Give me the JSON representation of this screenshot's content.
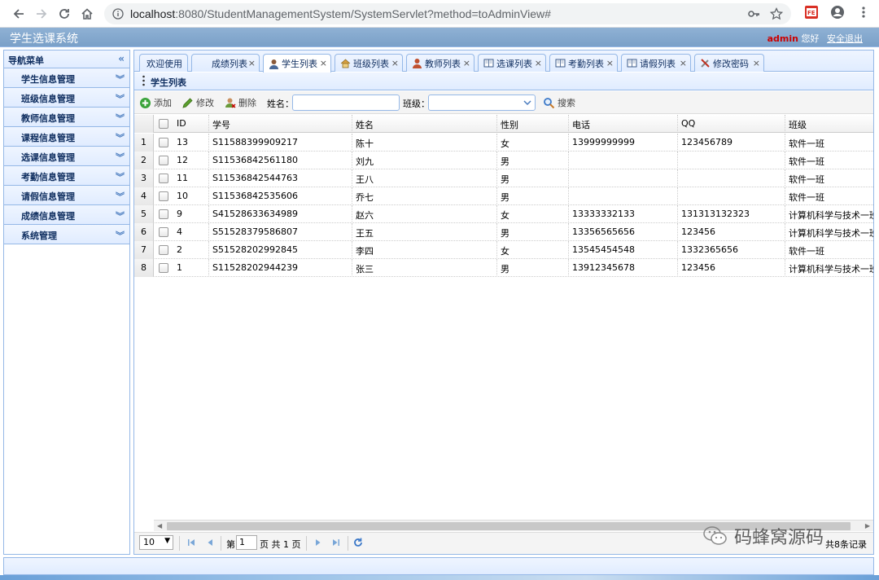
{
  "browser": {
    "url_host": "localhost",
    "url_path": ":8080/StudentManagementSystem/SystemServlet?method=toAdminView#"
  },
  "app": {
    "title": "学生选课系统",
    "user": "admin",
    "greeting": "您好",
    "logout": "安全退出"
  },
  "sidebar": {
    "title": "导航菜单",
    "items": [
      {
        "label": "学生信息管理"
      },
      {
        "label": "班级信息管理"
      },
      {
        "label": "教师信息管理"
      },
      {
        "label": "课程信息管理"
      },
      {
        "label": "选课信息管理"
      },
      {
        "label": "考勤信息管理"
      },
      {
        "label": "请假信息管理"
      },
      {
        "label": "成绩信息管理"
      },
      {
        "label": "系统管理"
      }
    ]
  },
  "tabs": [
    {
      "label": "欢迎使用",
      "icon": "none"
    },
    {
      "label": "成绩列表",
      "icon": "none"
    },
    {
      "label": "学生列表",
      "icon": "user-icon"
    },
    {
      "label": "班级列表",
      "icon": "house-icon"
    },
    {
      "label": "教师列表",
      "icon": "teacher-icon"
    },
    {
      "label": "选课列表",
      "icon": "book-icon"
    },
    {
      "label": "考勤列表",
      "icon": "book-icon"
    },
    {
      "label": "请假列表",
      "icon": "book-icon"
    },
    {
      "label": "修改密码",
      "icon": "tools-icon"
    }
  ],
  "panel": {
    "title": "学生列表"
  },
  "toolbar": {
    "add": "添加",
    "edit": "修改",
    "delete": "删除",
    "name_label": "姓名：",
    "name_value": "",
    "class_label": "班级：",
    "class_value": "",
    "search": "搜索"
  },
  "grid": {
    "columns": [
      "ID",
      "学号",
      "姓名",
      "性别",
      "电话",
      "QQ",
      "班级"
    ],
    "rows": [
      {
        "num": "1",
        "id": "13",
        "sn": "S11588399909217",
        "name": "陈十",
        "sex": "女",
        "phone": "13999999999",
        "qq": "123456789",
        "cls": "软件一班"
      },
      {
        "num": "2",
        "id": "12",
        "sn": "S11536842561180",
        "name": "刘九",
        "sex": "男",
        "phone": "",
        "qq": "",
        "cls": "软件一班"
      },
      {
        "num": "3",
        "id": "11",
        "sn": "S11536842544763",
        "name": "王八",
        "sex": "男",
        "phone": "",
        "qq": "",
        "cls": "软件一班"
      },
      {
        "num": "4",
        "id": "10",
        "sn": "S11536842535606",
        "name": "乔七",
        "sex": "男",
        "phone": "",
        "qq": "",
        "cls": "软件一班"
      },
      {
        "num": "5",
        "id": "9",
        "sn": "S41528633634989",
        "name": "赵六",
        "sex": "女",
        "phone": "13333332133",
        "qq": "131313132323",
        "cls": "计算机科学与技术一班"
      },
      {
        "num": "6",
        "id": "4",
        "sn": "S51528379586807",
        "name": "王五",
        "sex": "男",
        "phone": "13356565656",
        "qq": "123456",
        "cls": "计算机科学与技术一班"
      },
      {
        "num": "7",
        "id": "2",
        "sn": "S51528202992845",
        "name": "李四",
        "sex": "女",
        "phone": "13545454548",
        "qq": "1332365656",
        "cls": "软件一班"
      },
      {
        "num": "8",
        "id": "1",
        "sn": "S11528202944239",
        "name": "张三",
        "sex": "男",
        "phone": "13912345678",
        "qq": "123456",
        "cls": "计算机科学与技术一班"
      }
    ]
  },
  "pager": {
    "page_size": "10",
    "page_prefix": "第",
    "page_value": "1",
    "page_suffix": "页 共 1 页",
    "info": "共8条记录"
  },
  "watermark": {
    "text": "码蜂窝源码"
  }
}
